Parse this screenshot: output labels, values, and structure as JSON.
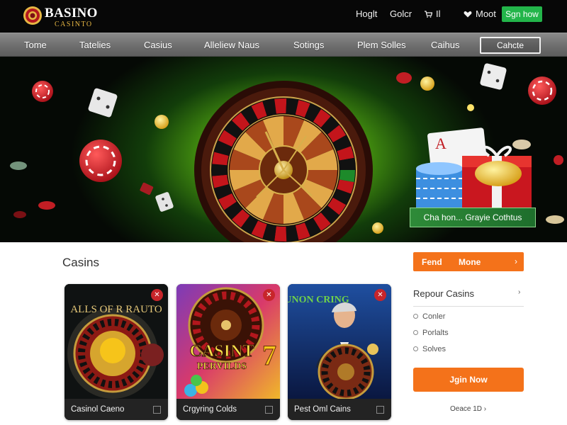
{
  "header": {
    "brand": "BASINO",
    "brand_sub": "CASINTO",
    "links": [
      "Hoglt",
      "Golcr",
      "Il",
      "Moot"
    ],
    "signup_label": "Sgn how"
  },
  "nav": {
    "items": [
      "Tome",
      "Tatelies",
      "Casius",
      "Alleliew Naus",
      "Sotings",
      "Plem Solles",
      "Caihus"
    ],
    "button_label": "Cahcte"
  },
  "hero": {
    "banner_text": "Cha hon... Grayie Cothtus"
  },
  "main": {
    "section_title": "Casins",
    "cards": [
      {
        "caption": "Casinol Caeno",
        "art_title": "ALLS OF R RAUTO"
      },
      {
        "caption": "Crgyring Colds",
        "art_title": "CASINT",
        "art_subtitle": "PERVILDS",
        "art_number": "7"
      },
      {
        "caption": "Pest Oml Cains",
        "art_title": "AUNON CRING"
      }
    ],
    "badge_symbol": "✕"
  },
  "sidebar": {
    "top_button": {
      "left": "Fend",
      "right": "Mone",
      "arrow": "›"
    },
    "heading": "Repour Casins",
    "heading_arrow": "›",
    "items": [
      "Conler",
      "Porlalts",
      "Solves"
    ],
    "join_label": "Jgin Now",
    "footer_note": "Oeace 1D ›"
  },
  "colors": {
    "header_bg": "#070707",
    "accent_green": "#23b54a",
    "accent_orange": "#f4721a",
    "gold": "#e6b643",
    "chip_red": "#d2202b"
  }
}
